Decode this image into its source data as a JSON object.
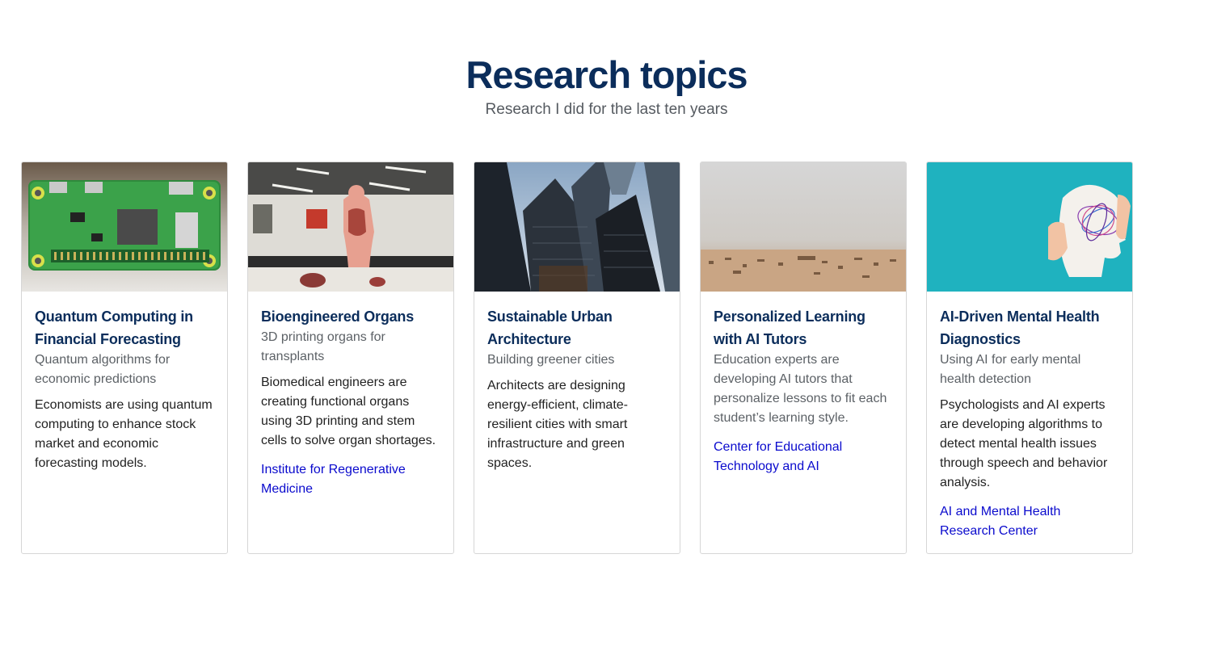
{
  "header": {
    "title": "Research topics",
    "subtitle": "Research I did for the last ten years"
  },
  "colors": {
    "title": "#0b2d5b",
    "link": "#0a0acd",
    "border": "#d6d6d6"
  },
  "cards": [
    {
      "image": "circuit-board-photo",
      "title": "Quantum Computing in Financial Forecasting",
      "subtitle": "Quantum algorithms for economic predictions",
      "text": "Economists are using quantum computing to enhance stock market and economic forecasting models.",
      "link": ""
    },
    {
      "image": "anatomy-model-photo",
      "title": "Bioengineered Organs",
      "subtitle": "3D printing organs for transplants",
      "text": "Biomedical engineers are creating functional organs using 3D printing and stem cells to solve organ shortages.",
      "link": "Institute for Regenerative Medicine"
    },
    {
      "image": "skyscrapers-photo",
      "title": "Sustainable Urban Architecture",
      "subtitle": "Building greener cities",
      "text": "Architects are designing energy-efficient, climate-resilient cities with smart infrastructure and green spaces.",
      "link": ""
    },
    {
      "image": "scattered-letters-photo",
      "title": "Personalized Learning with AI Tutors",
      "subtitle": "Education experts are developing AI tutors that personalize lessons to fit each student’s learning style.",
      "text": "",
      "link": "Center for Educational Technology and AI"
    },
    {
      "image": "head-silhouette-photo",
      "title": "AI-Driven Mental Health Diagnostics",
      "subtitle": "Using AI for early mental health detection",
      "text": "Psychologists and AI experts are developing algorithms to detect mental health issues through speech and behavior analysis.",
      "link": "AI and Mental Health Research Center"
    }
  ]
}
